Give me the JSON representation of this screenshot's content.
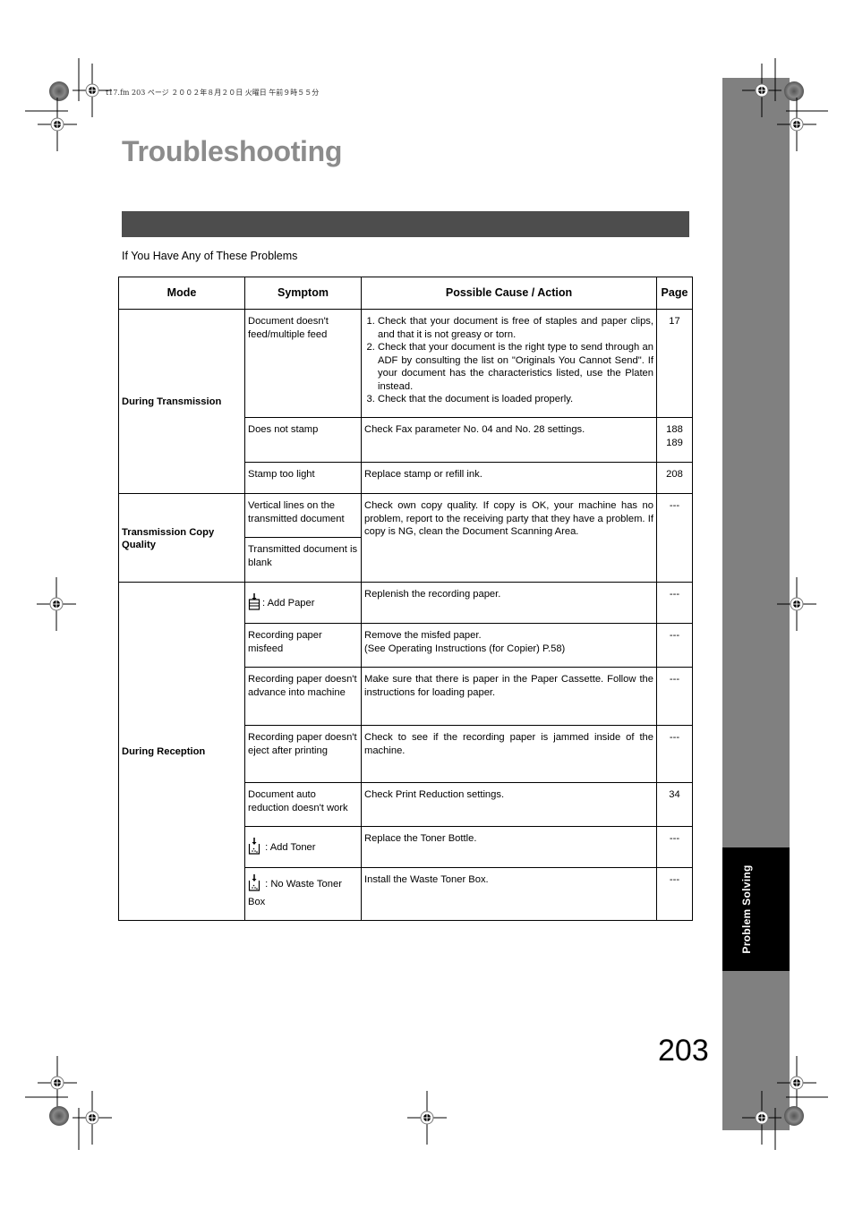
{
  "header_line": "t17.fm  203 ページ  ２００２年８月２０日  火曜日  午前９時５５分",
  "page_title": "Troubleshooting",
  "intro": "If You Have Any of These Problems",
  "side_tab": "Problem Solving",
  "page_number": "203",
  "table": {
    "headers": {
      "mode": "Mode",
      "symptom": "Symptom",
      "cause": "Possible Cause / Action",
      "page": "Page"
    },
    "groups": [
      {
        "mode": "During Transmission",
        "rows": [
          {
            "symptom": "Document doesn't feed/multiple feed",
            "cause_steps": [
              "Check that your document is free of staples and paper clips, and that it is not greasy or torn.",
              "Check that your document is the right type to send through an ADF by consulting the list on \"Originals You Cannot Send\".  If your document has the characteristics listed, use the Platen instead.",
              "Check that the document is loaded properly."
            ],
            "page": "17"
          },
          {
            "symptom": "Does not stamp",
            "cause": "Check Fax parameter No. 04 and No. 28 settings.",
            "page": "188\n189"
          },
          {
            "symptom": "Stamp too light",
            "cause": "Replace stamp or refill ink.",
            "page": "208"
          }
        ]
      },
      {
        "mode": "Transmission Copy Quality",
        "rows": [
          {
            "symptom": "Vertical lines on the transmitted document",
            "cause": "Check own copy quality.  If copy is OK, your machine has no problem, report to the receiving party that they have a problem.  If copy is NG, clean the Document Scanning Area.",
            "page": "---"
          },
          {
            "symptom": "Transmitted document is blank"
          }
        ]
      },
      {
        "mode": "During Reception",
        "rows": [
          {
            "icon": "add-paper-icon",
            "symptom": ": Add Paper",
            "cause": "Replenish the recording paper.",
            "page": "---"
          },
          {
            "symptom": "Recording paper misfeed",
            "cause": "Remove the misfed paper.",
            "cause_line2": "(See Operating Instructions (for Copier) P.58)",
            "page": "---"
          },
          {
            "symptom": "Recording paper doesn't advance into machine",
            "cause": "Make sure that there is paper in the Paper Cassette. Follow the instructions for loading paper.",
            "page": "---"
          },
          {
            "symptom": "Recording paper doesn't eject after printing",
            "cause": "Check to see if the recording paper is jammed inside of the machine.",
            "page": "---"
          },
          {
            "symptom": "Document auto reduction doesn't work",
            "cause": "Check Print Reduction settings.",
            "page": "34"
          },
          {
            "icon": "add-toner-icon",
            "symptom": " : Add Toner",
            "cause": "Replace the Toner Bottle.",
            "page": "---"
          },
          {
            "icon": "waste-toner-icon",
            "symptom": " : No Waste Toner Box",
            "cause": "Install the Waste Toner Box.",
            "page": "---"
          }
        ]
      }
    ]
  }
}
